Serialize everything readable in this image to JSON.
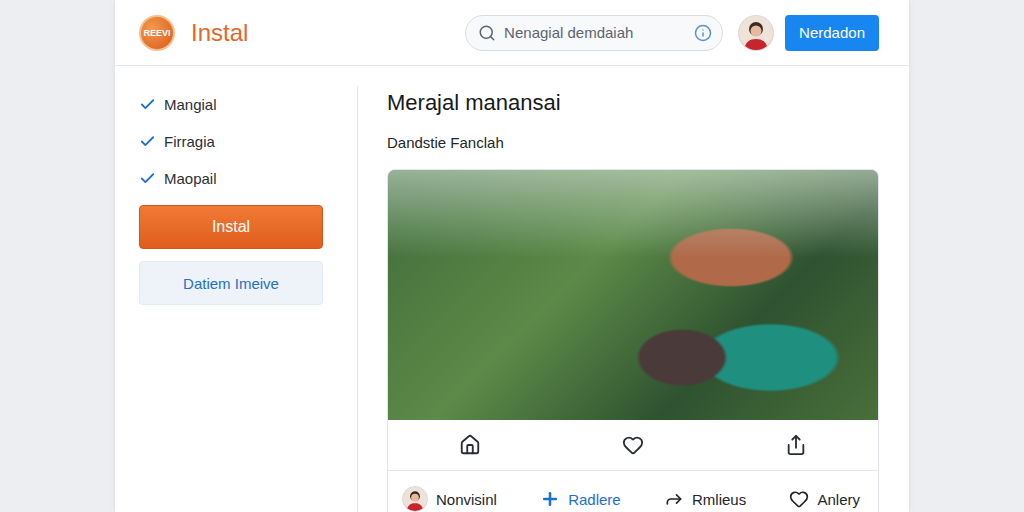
{
  "brand": {
    "logo": "REEVI",
    "name": "Instal"
  },
  "search": {
    "placeholder": "Nenagial demdaiah"
  },
  "header_button": "Nerdadon",
  "sidebar": {
    "items": [
      {
        "label": "Mangial",
        "checked": true
      },
      {
        "label": "Firragia",
        "checked": true
      },
      {
        "label": "Maopail",
        "checked": true
      }
    ],
    "primary_button": "Instal",
    "secondary_button": "Datiem Imeive"
  },
  "post": {
    "title": "Merajal manansai",
    "subtitle": "Dandstie Fanclah",
    "footer": [
      {
        "label": "Nonvisinl",
        "kind": "user"
      },
      {
        "label": "Radlere",
        "kind": "add"
      },
      {
        "label": "Rmlieus",
        "kind": "share"
      },
      {
        "label": "Anlery",
        "kind": "like"
      }
    ]
  }
}
